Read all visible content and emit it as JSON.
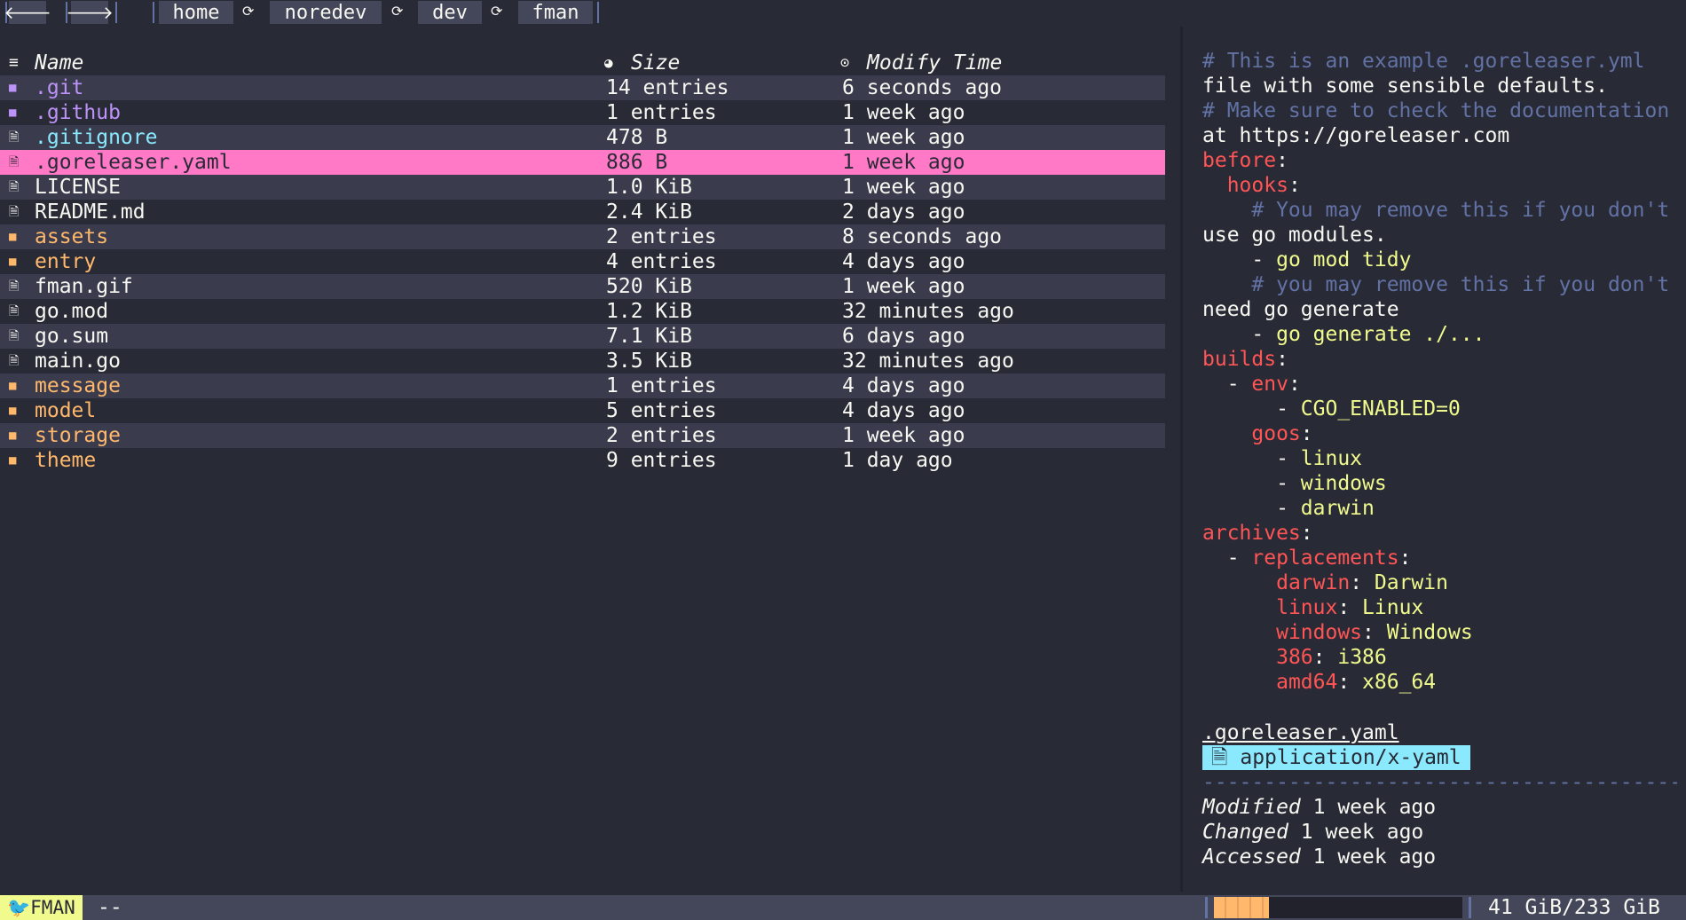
{
  "nav": {
    "back_label": "🡐",
    "forward_label": "🡒",
    "link_glyph": "⟳",
    "breadcrumb": [
      "home",
      "noredev",
      "dev",
      "fman"
    ]
  },
  "columns": {
    "name": "Name",
    "size": "Size",
    "modify_time": "Modify Time",
    "name_icon": "list-icon",
    "size_icon": "pie-icon",
    "time_icon": "clock-icon"
  },
  "files": [
    {
      "name": ".git",
      "size": "14 entries",
      "time": "6 seconds ago",
      "type": "dir",
      "color": "#bd93f9"
    },
    {
      "name": ".github",
      "size": "1 entries",
      "time": "1 week ago",
      "type": "dir",
      "color": "#bd93f9"
    },
    {
      "name": ".gitignore",
      "size": "478 B",
      "time": "1 week ago",
      "type": "file",
      "color": "#8be9fd"
    },
    {
      "name": ".goreleaser.yaml",
      "size": "886 B",
      "time": "1 week ago",
      "type": "file",
      "color": "#282a36",
      "selected": true
    },
    {
      "name": "LICENSE",
      "size": "1.0 KiB",
      "time": "1 week ago",
      "type": "file",
      "color": "#f8f8f2"
    },
    {
      "name": "README.md",
      "size": "2.4 KiB",
      "time": "2 days ago",
      "type": "file",
      "color": "#f8f8f2"
    },
    {
      "name": "assets",
      "size": "2 entries",
      "time": "8 seconds ago",
      "type": "dir",
      "color": "#ffb86c"
    },
    {
      "name": "entry",
      "size": "4 entries",
      "time": "4 days ago",
      "type": "dir",
      "color": "#ffb86c"
    },
    {
      "name": "fman.gif",
      "size": "520 KiB",
      "time": "1 week ago",
      "type": "file",
      "color": "#f8f8f2"
    },
    {
      "name": "go.mod",
      "size": "1.2 KiB",
      "time": "32 minutes ago",
      "type": "file",
      "color": "#f8f8f2"
    },
    {
      "name": "go.sum",
      "size": "7.1 KiB",
      "time": "6 days ago",
      "type": "file",
      "color": "#f8f8f2"
    },
    {
      "name": "main.go",
      "size": "3.5 KiB",
      "time": "32 minutes ago",
      "type": "file",
      "color": "#f8f8f2"
    },
    {
      "name": "message",
      "size": "1 entries",
      "time": "4 days ago",
      "type": "dir",
      "color": "#ffb86c"
    },
    {
      "name": "model",
      "size": "5 entries",
      "time": "4 days ago",
      "type": "dir",
      "color": "#ffb86c"
    },
    {
      "name": "storage",
      "size": "2 entries",
      "time": "1 week ago",
      "type": "dir",
      "color": "#ffb86c"
    },
    {
      "name": "theme",
      "size": "9 entries",
      "time": "1 day ago",
      "type": "dir",
      "color": "#ffb86c"
    }
  ],
  "preview": {
    "lines": [
      [
        [
          "cm",
          "# This is an example .goreleaser.yml"
        ]
      ],
      [
        [
          "tx",
          "file with some sensible defaults."
        ]
      ],
      [
        [
          "cm",
          "# Make sure to check the documentation"
        ]
      ],
      [
        [
          "tx",
          "at https://goreleaser.com"
        ]
      ],
      [
        [
          "ky",
          "before"
        ],
        [
          "tx",
          ":"
        ]
      ],
      [
        [
          "tx",
          "  "
        ],
        [
          "ky",
          "hooks"
        ],
        [
          "tx",
          ":"
        ]
      ],
      [
        [
          "cm",
          "    # You may remove this if you don't"
        ]
      ],
      [
        [
          "tx",
          "use go modules."
        ]
      ],
      [
        [
          "tx",
          "    - "
        ],
        [
          "vl",
          "go mod tidy"
        ]
      ],
      [
        [
          "cm",
          "    # you may remove this if you don't"
        ]
      ],
      [
        [
          "tx",
          "need go generate"
        ]
      ],
      [
        [
          "tx",
          "    - "
        ],
        [
          "vl",
          "go generate ./..."
        ]
      ],
      [
        [
          "ky",
          "builds"
        ],
        [
          "tx",
          ":"
        ]
      ],
      [
        [
          "tx",
          "  - "
        ],
        [
          "ky",
          "env"
        ],
        [
          "tx",
          ":"
        ]
      ],
      [
        [
          "tx",
          "      - "
        ],
        [
          "vl",
          "CGO_ENABLED=0"
        ]
      ],
      [
        [
          "tx",
          "    "
        ],
        [
          "ky",
          "goos"
        ],
        [
          "tx",
          ":"
        ]
      ],
      [
        [
          "tx",
          "      - "
        ],
        [
          "vl",
          "linux"
        ]
      ],
      [
        [
          "tx",
          "      - "
        ],
        [
          "vl",
          "windows"
        ]
      ],
      [
        [
          "tx",
          "      - "
        ],
        [
          "vl",
          "darwin"
        ]
      ],
      [
        [
          "ky",
          "archives"
        ],
        [
          "tx",
          ":"
        ]
      ],
      [
        [
          "tx",
          "  - "
        ],
        [
          "ky",
          "replacements"
        ],
        [
          "tx",
          ":"
        ]
      ],
      [
        [
          "tx",
          "      "
        ],
        [
          "ky",
          "darwin"
        ],
        [
          "tx",
          ": "
        ],
        [
          "vl",
          "Darwin"
        ]
      ],
      [
        [
          "tx",
          "      "
        ],
        [
          "ky",
          "linux"
        ],
        [
          "tx",
          ": "
        ],
        [
          "vl",
          "Linux"
        ]
      ],
      [
        [
          "tx",
          "      "
        ],
        [
          "ky",
          "windows"
        ],
        [
          "tx",
          ": "
        ],
        [
          "vl",
          "Windows"
        ]
      ],
      [
        [
          "tx",
          "      "
        ],
        [
          "ky",
          "386"
        ],
        [
          "tx",
          ": "
        ],
        [
          "vl",
          "i386"
        ]
      ],
      [
        [
          "tx",
          "      "
        ],
        [
          "ky",
          "amd64"
        ],
        [
          "tx",
          ": "
        ],
        [
          "vl",
          "x86_64"
        ]
      ]
    ]
  },
  "file_info": {
    "name": ".goreleaser.yaml",
    "mime": "application/x-yaml",
    "mime_icon": "file-icon",
    "modified_label": "Modified",
    "modified_value": "1 week ago",
    "changed_label": "Changed",
    "changed_value": "1 week ago",
    "accessed_label": "Accessed",
    "accessed_value": "1 week ago"
  },
  "status": {
    "mode": "FMAN",
    "mode_icon": "bird-icon",
    "message": "--",
    "disk_usage_fraction": 0.176,
    "disk": "41 GiB/233 GiB"
  },
  "colors": {
    "background": "#282a36",
    "selection": "#ff79c6",
    "dir_hidden": "#bd93f9",
    "dir": "#ffb86c",
    "accent_cyan": "#8be9fd",
    "status_yellow": "#f1fa8c"
  }
}
